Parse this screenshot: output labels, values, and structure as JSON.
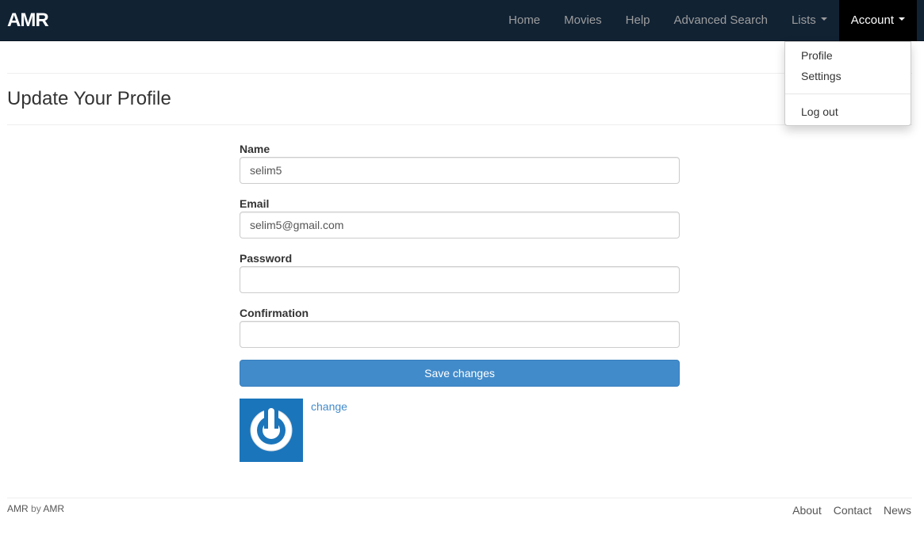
{
  "navbar": {
    "brand": "AMR",
    "links": [
      "Home",
      "Movies",
      "Help",
      "Advanced Search",
      "Lists",
      "Account"
    ]
  },
  "dropdown": {
    "items": [
      "Profile",
      "Settings",
      "Log out"
    ]
  },
  "page": {
    "title": "Update Your Profile"
  },
  "form": {
    "name_label": "Name",
    "name_value": "selim5",
    "email_label": "Email",
    "email_value": "selim5@gmail.com",
    "password_label": "Password",
    "password_value": "",
    "confirmation_label": "Confirmation",
    "confirmation_value": "",
    "save_label": "Save changes",
    "avatar_icon": "power-icon",
    "change_label": "change"
  },
  "footer": {
    "brand": "AMR",
    "by": "by",
    "author": "AMR",
    "links": [
      "About",
      "Contact",
      "News"
    ]
  },
  "colors": {
    "navbar_bg": "#112233",
    "primary": "#428bca",
    "avatar_bg": "#1b75bb"
  }
}
